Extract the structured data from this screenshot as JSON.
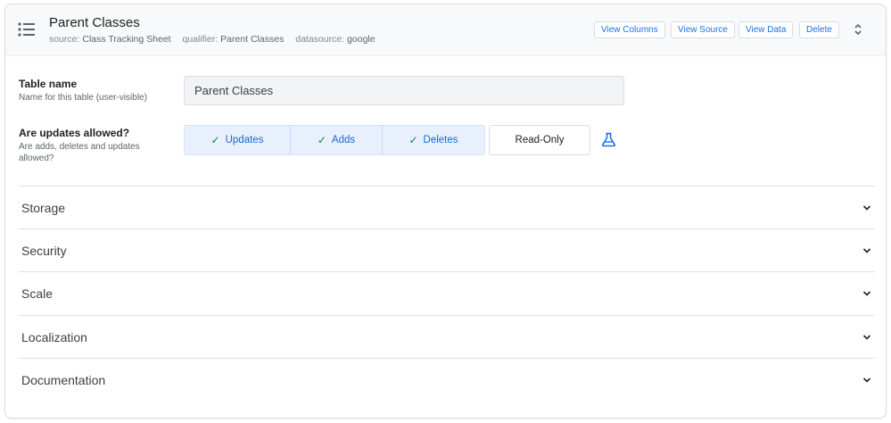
{
  "header": {
    "title": "Parent Classes",
    "meta": [
      {
        "key": "source:",
        "value": "Class Tracking Sheet"
      },
      {
        "key": "qualifier:",
        "value": "Parent Classes"
      },
      {
        "key": "datasource:",
        "value": "google"
      }
    ],
    "buttons": {
      "view_columns": "View Columns",
      "view_source": "View Source",
      "view_data": "View Data",
      "delete": "Delete"
    }
  },
  "table_name": {
    "label": "Table name",
    "sublabel": "Name for this table (user-visible)",
    "value": "Parent Classes"
  },
  "updates": {
    "label": "Are updates allowed?",
    "sublabel": "Are adds, deletes and updates allowed?",
    "options": [
      {
        "label": "Updates",
        "selected": true
      },
      {
        "label": "Adds",
        "selected": true
      },
      {
        "label": "Deletes",
        "selected": true
      },
      {
        "label": "Read-Only",
        "selected": false
      }
    ]
  },
  "sections": [
    "Storage",
    "Security",
    "Scale",
    "Localization",
    "Documentation"
  ],
  "colors": {
    "accent": "#1a73e8",
    "selected_bg": "#e8f0fe",
    "check": "#188038",
    "border": "#dadce0"
  }
}
